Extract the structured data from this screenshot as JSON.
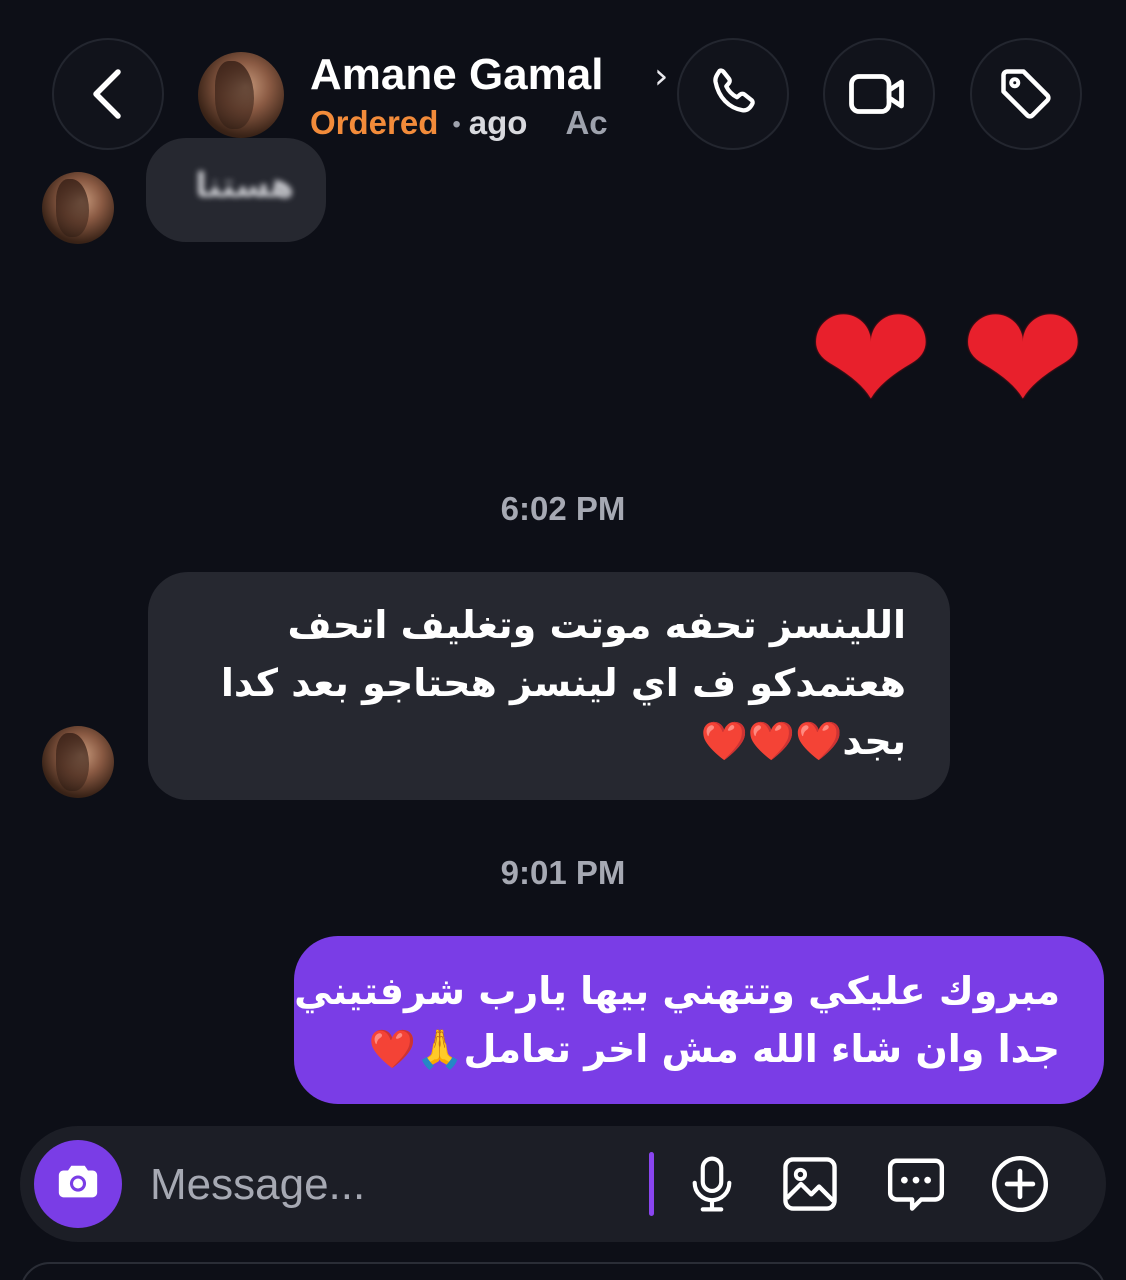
{
  "header": {
    "back_icon": "chevron-left-icon",
    "contact_name": "Amane Gamal",
    "name_chevron": "›",
    "status_label": "Ordered",
    "status_separator": "•",
    "time_ago": "ago",
    "truncated_text": "Ac",
    "actions": [
      "phone-icon",
      "video-camera-icon",
      "tag-icon"
    ]
  },
  "messages": {
    "blurred_incoming": "هستنا",
    "heart_emoji": "❤",
    "timestamp_1": "6:02 PM",
    "incoming_text": {
      "line1": "اللينسز تحفه موتت وتغليف اتحف",
      "line2": "هعتمدكو ف اي لينسز هحتاجو بعد كدا",
      "line3": "بجد",
      "hearts": "❤️❤️❤️"
    },
    "timestamp_2": "9:01 PM",
    "outgoing_text": {
      "line1": "مبروك عليكي وتتهني بيها يارب شرفتيني",
      "line2": "جدا وان شاء الله مش اخر تعامل",
      "emoji": "🙏❤️"
    }
  },
  "composer": {
    "placeholder": "Message...",
    "icons": [
      "camera-icon",
      "microphone-icon",
      "image-icon",
      "sticker-chat-icon",
      "plus-circle-icon"
    ]
  },
  "colors": {
    "background": "#0d0f17",
    "accent_purple": "#7a3de6",
    "ordered_orange": "#f28b3a",
    "incoming_bubble": "#262830"
  }
}
